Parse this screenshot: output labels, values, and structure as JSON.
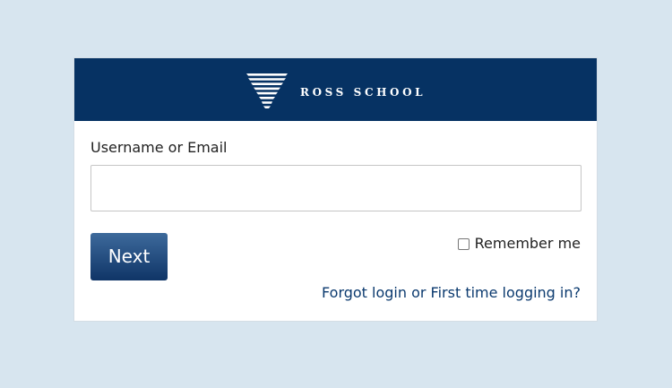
{
  "brand": {
    "name": "ROSS SCHOOL",
    "logo_icon": "ross-school-logo-icon",
    "header_color": "#063263"
  },
  "form": {
    "username_label": "Username or Email",
    "username_value": "",
    "username_placeholder": "",
    "next_button": "Next",
    "remember_label": "Remember me",
    "remember_checked": false,
    "forgot_link": "Forgot login or First time logging in?"
  },
  "colors": {
    "page_background": "#d7e5ef",
    "button": "#1f4a7d",
    "link": "#0b3a6f"
  }
}
